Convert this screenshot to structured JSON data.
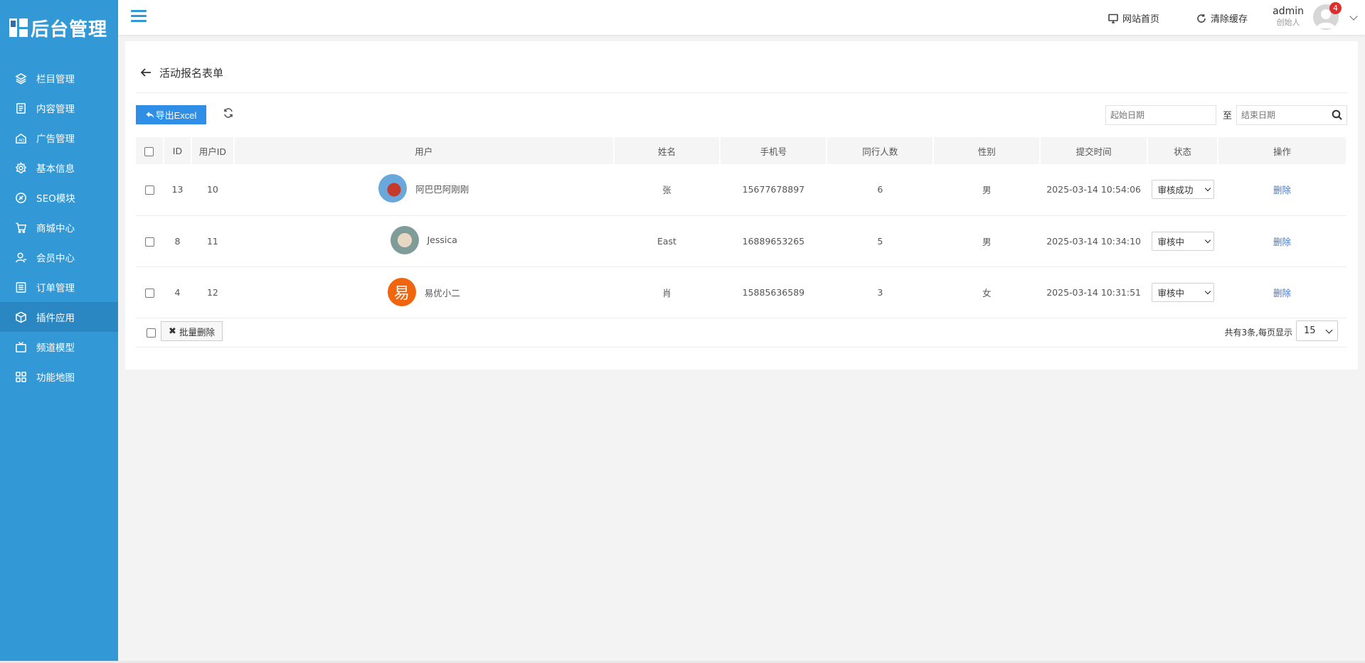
{
  "logo": {
    "text": "后台管理"
  },
  "sidebar": {
    "items": [
      {
        "label": "栏目管理",
        "icon": "layers-icon"
      },
      {
        "label": "内容管理",
        "icon": "document-icon"
      },
      {
        "label": "广告管理",
        "icon": "ad-icon"
      },
      {
        "label": "基本信息",
        "icon": "gear-icon"
      },
      {
        "label": "SEO模块",
        "icon": "seo-icon"
      },
      {
        "label": "商城中心",
        "icon": "cart-icon"
      },
      {
        "label": "会员中心",
        "icon": "user-icon"
      },
      {
        "label": "订单管理",
        "icon": "list-icon"
      },
      {
        "label": "插件应用",
        "icon": "cube-icon",
        "active": true
      },
      {
        "label": "频道模型",
        "icon": "tv-icon"
      },
      {
        "label": "功能地图",
        "icon": "grid-icon"
      }
    ]
  },
  "topbar": {
    "site_home": "网站首页",
    "clear_cache": "清除缓存",
    "user_name": "admin",
    "user_role": "创始人",
    "notification_count": "4"
  },
  "page": {
    "title": "活动报名表单",
    "export_label": "导出Excel",
    "start_date_placeholder": "起始日期",
    "end_date_placeholder": "结束日期",
    "date_separator": "至"
  },
  "table": {
    "headers": [
      "ID",
      "用户ID",
      "用户",
      "姓名",
      "手机号",
      "同行人数",
      "性别",
      "提交时间",
      "状态",
      "操作"
    ],
    "rows": [
      {
        "id": "13",
        "user_id": "10",
        "user": "阿巴巴阿刚刚",
        "name": "张",
        "phone": "15677678897",
        "companions": "6",
        "gender": "男",
        "time": "2025-03-14 10:54:06",
        "status": "审核成功",
        "action": "删除"
      },
      {
        "id": "8",
        "user_id": "11",
        "user": "Jessica",
        "name": "East",
        "phone": "16889653265",
        "companions": "5",
        "gender": "男",
        "time": "2025-03-14 10:34:10",
        "status": "审核中",
        "action": "删除"
      },
      {
        "id": "4",
        "user_id": "12",
        "user": "易优小二",
        "avatar_text": "易",
        "name": "肖",
        "phone": "15885636589",
        "companions": "3",
        "gender": "女",
        "time": "2025-03-14 10:31:51",
        "status": "审核中",
        "action": "删除"
      }
    ]
  },
  "footer": {
    "batch_delete": "批量删除",
    "page_info": "共有3条,每页显示",
    "page_size": "15"
  }
}
